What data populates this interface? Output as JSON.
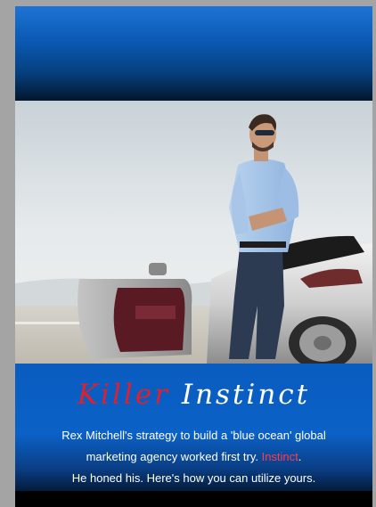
{
  "cover": {
    "headline": {
      "word1": "Killer",
      "word2": "Instinct"
    },
    "body": {
      "line1": "Rex Mitchell's strategy to build a 'blue ocean' global",
      "line2_prefix": "marketing agency worked first try.",
      "line2_highlight": "Instinct",
      "line2_suffix": ".",
      "line3": "He honed his. Here's how you can utilize yours."
    }
  },
  "colors": {
    "accent_red": "#e0202a",
    "band_blue": "#0b5bb6",
    "frame_gray": "#a4a4a4"
  }
}
